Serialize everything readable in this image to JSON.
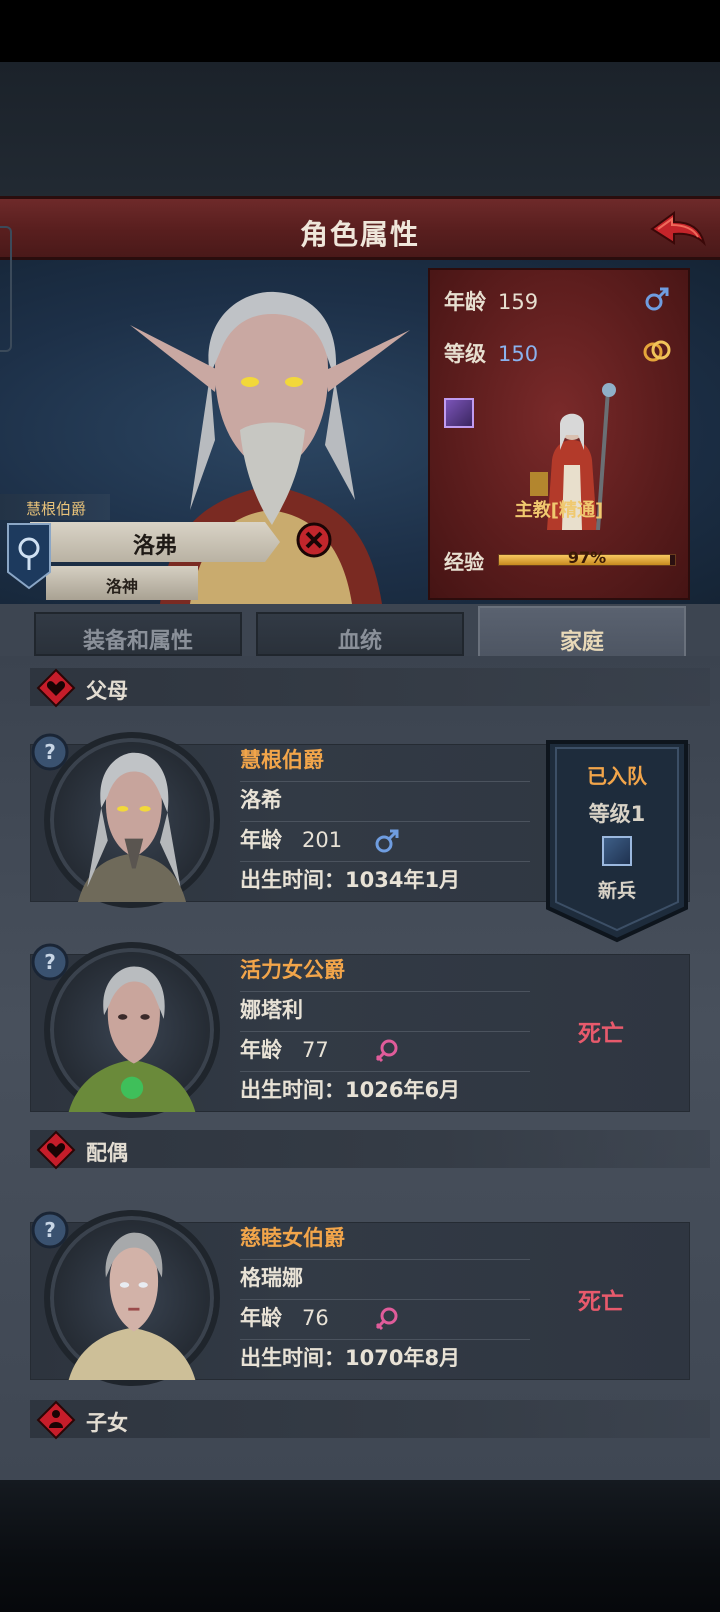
{
  "header": {
    "title": "角色属性"
  },
  "hero": {
    "noble_title": "慧根伯爵",
    "name": "洛弗",
    "house": "洛神"
  },
  "stats": {
    "age_label": "年龄",
    "age_value": "159",
    "level_label": "等级",
    "level_value": "150",
    "class_name": "主教[精通]",
    "exp_label": "经验",
    "exp_text": "97%",
    "exp_fraction": 0.97,
    "gender_icon": "male-icon",
    "spouse_icon": "wedding-rings-icon"
  },
  "tabs": [
    {
      "label": "装备和属性",
      "active": false
    },
    {
      "label": "血统",
      "active": false
    },
    {
      "label": "家庭",
      "active": true
    }
  ],
  "sections": {
    "parents": "父母",
    "spouse": "配偶",
    "children": "子女"
  },
  "members": [
    {
      "title": "慧根伯爵",
      "name": "洛希",
      "age_label": "年龄",
      "age": "201",
      "gender": "male",
      "birth": "出生时间：1034年1月"
    },
    {
      "title": "活力女公爵",
      "name": "娜塔利",
      "age_label": "年龄",
      "age": "77",
      "gender": "female",
      "birth": "出生时间：1026年6月",
      "status": "死亡"
    },
    {
      "title": "慈睦女伯爵",
      "name": "格瑞娜",
      "age_label": "年龄",
      "age": "76",
      "gender": "female",
      "birth": "出生时间：1070年8月",
      "status": "死亡"
    }
  ],
  "recruit": {
    "status": "已入队",
    "level": "等级1",
    "rank": "新兵"
  },
  "colors": {
    "accent_orange": "#f2a54a",
    "dead_red": "#e85a6c",
    "male_blue": "#6f9de0",
    "female_pink": "#e05c9a"
  }
}
